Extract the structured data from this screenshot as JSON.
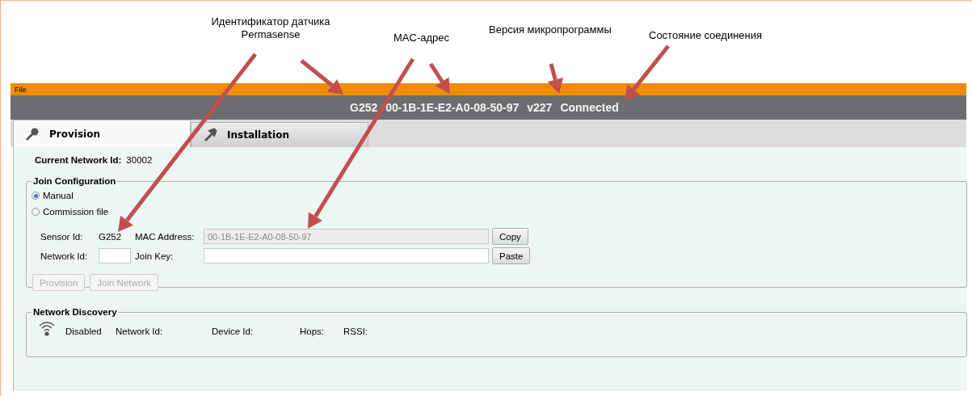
{
  "annotations": [
    {
      "text": "Идентификатор датчика Permasense"
    },
    {
      "text": "MAC-адрес"
    },
    {
      "text": "Версия микропрограммы"
    },
    {
      "text": "Состояние соединения"
    }
  ],
  "menu": [
    "File"
  ],
  "header": [
    "G252",
    "00-1B-1E-E2-A0-08-50-97",
    "v227",
    "Connected"
  ],
  "tabs": [
    {
      "label": "Provision",
      "selected": true
    },
    {
      "label": "Installation",
      "selected": false
    }
  ],
  "current_network": {
    "label": "Current Network Id:",
    "value": "30002"
  },
  "join_configuration": {
    "title": "Join Configuration",
    "radios": [
      {
        "label": "Manual",
        "selected": true
      },
      {
        "label": "Commission file",
        "selected": false
      }
    ],
    "sensor_id": {
      "label": "Sensor Id:",
      "value": "G252"
    },
    "mac_address": {
      "label": "MAC Address:",
      "value": "00-1B-1E-E2-A0-08-50-97",
      "button": "Copy"
    },
    "network_id": {
      "label": "Network Id:"
    },
    "join_key": {
      "label": "Join Key:",
      "button": "Paste"
    },
    "actions": [
      {
        "label": "Provision",
        "disabled": true
      },
      {
        "label": "Join Network",
        "disabled": true
      }
    ]
  },
  "network_discovery": {
    "title": "Network Discovery",
    "status": "Disabled",
    "fields": [
      "Network Id:",
      "Device Id:",
      "Hops:",
      "RSSI:"
    ]
  }
}
